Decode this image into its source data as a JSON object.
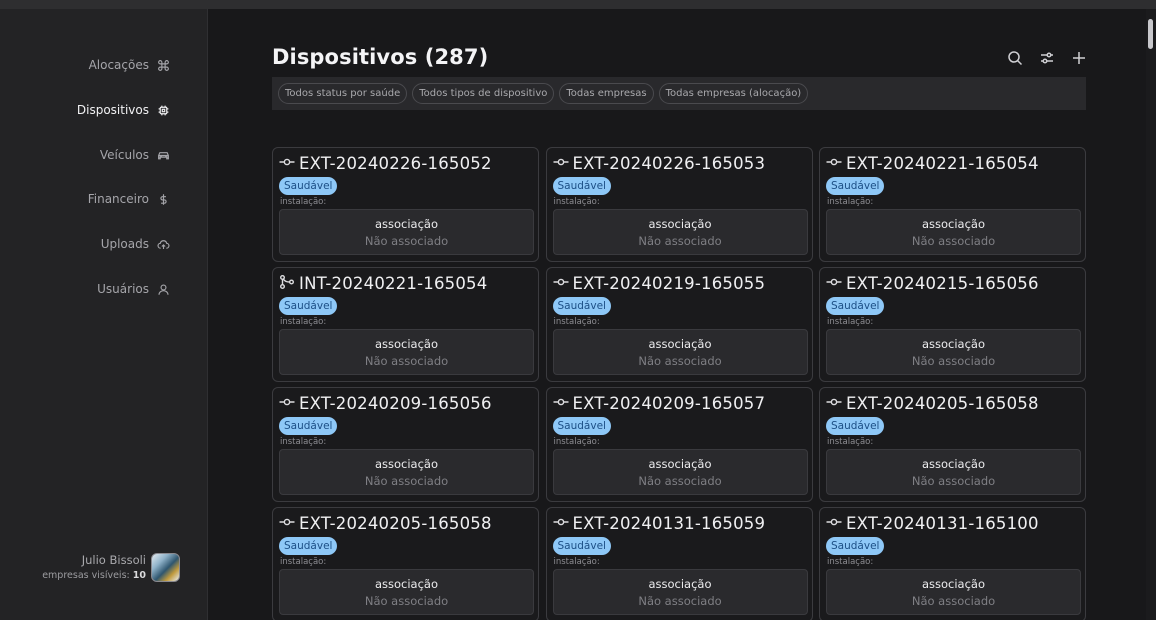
{
  "sidebar": {
    "items": [
      {
        "label": "Alocações",
        "icon": "command-icon",
        "active": false
      },
      {
        "label": "Dispositivos",
        "icon": "chip-icon",
        "active": true
      },
      {
        "label": "Veículos",
        "icon": "car-icon",
        "active": false
      },
      {
        "label": "Financeiro",
        "icon": "dollar-icon",
        "active": false
      },
      {
        "label": "Uploads",
        "icon": "cloud-upload-icon",
        "active": false
      },
      {
        "label": "Usuários",
        "icon": "user-icon",
        "active": false
      }
    ],
    "user": {
      "name": "Julio Bissoli",
      "visible_label": "empresas visíveis:",
      "visible_count": "10"
    }
  },
  "header": {
    "title": "Dispositivos (287)",
    "actions": [
      "search-icon",
      "filter-sliders-icon",
      "plus-icon"
    ]
  },
  "filters": [
    "Todos status por saúde",
    "Todos tipos de dispositivo",
    "Todas empresas",
    "Todas empresas (alocação)"
  ],
  "cards": [
    {
      "id": "EXT-20240226-165052",
      "type": "ext",
      "status": "Saudável",
      "install_label": "instalação:",
      "assoc_title": "associação",
      "assoc_status": "Não associado"
    },
    {
      "id": "EXT-20240226-165053",
      "type": "ext",
      "status": "Saudável",
      "install_label": "instalação:",
      "assoc_title": "associação",
      "assoc_status": "Não associado"
    },
    {
      "id": "EXT-20240221-165054",
      "type": "ext",
      "status": "Saudável",
      "install_label": "instalação:",
      "assoc_title": "associação",
      "assoc_status": "Não associado"
    },
    {
      "id": "INT-20240221-165054",
      "type": "int",
      "status": "Saudável",
      "install_label": "instalação:",
      "assoc_title": "associação",
      "assoc_status": "Não associado"
    },
    {
      "id": "EXT-20240219-165055",
      "type": "ext",
      "status": "Saudável",
      "install_label": "instalação:",
      "assoc_title": "associação",
      "assoc_status": "Não associado"
    },
    {
      "id": "EXT-20240215-165056",
      "type": "ext",
      "status": "Saudável",
      "install_label": "instalação:",
      "assoc_title": "associação",
      "assoc_status": "Não associado"
    },
    {
      "id": "EXT-20240209-165056",
      "type": "ext",
      "status": "Saudável",
      "install_label": "instalação:",
      "assoc_title": "associação",
      "assoc_status": "Não associado"
    },
    {
      "id": "EXT-20240209-165057",
      "type": "ext",
      "status": "Saudável",
      "install_label": "instalação:",
      "assoc_title": "associação",
      "assoc_status": "Não associado"
    },
    {
      "id": "EXT-20240205-165058",
      "type": "ext",
      "status": "Saudável",
      "install_label": "instalação:",
      "assoc_title": "associação",
      "assoc_status": "Não associado"
    },
    {
      "id": "EXT-20240205-165058",
      "type": "ext",
      "status": "Saudável",
      "install_label": "instalação:",
      "assoc_title": "associação",
      "assoc_status": "Não associado"
    },
    {
      "id": "EXT-20240131-165059",
      "type": "ext",
      "status": "Saudável",
      "install_label": "instalação:",
      "assoc_title": "associação",
      "assoc_status": "Não associado"
    },
    {
      "id": "EXT-20240131-165100",
      "type": "ext",
      "status": "Saudável",
      "install_label": "instalação:",
      "assoc_title": "associação",
      "assoc_status": "Não associado"
    }
  ],
  "colors": {
    "badge_bg": "#8ec8f7",
    "badge_text": "#1c4f86",
    "background": "#18181a",
    "sidebar": "#232325"
  }
}
